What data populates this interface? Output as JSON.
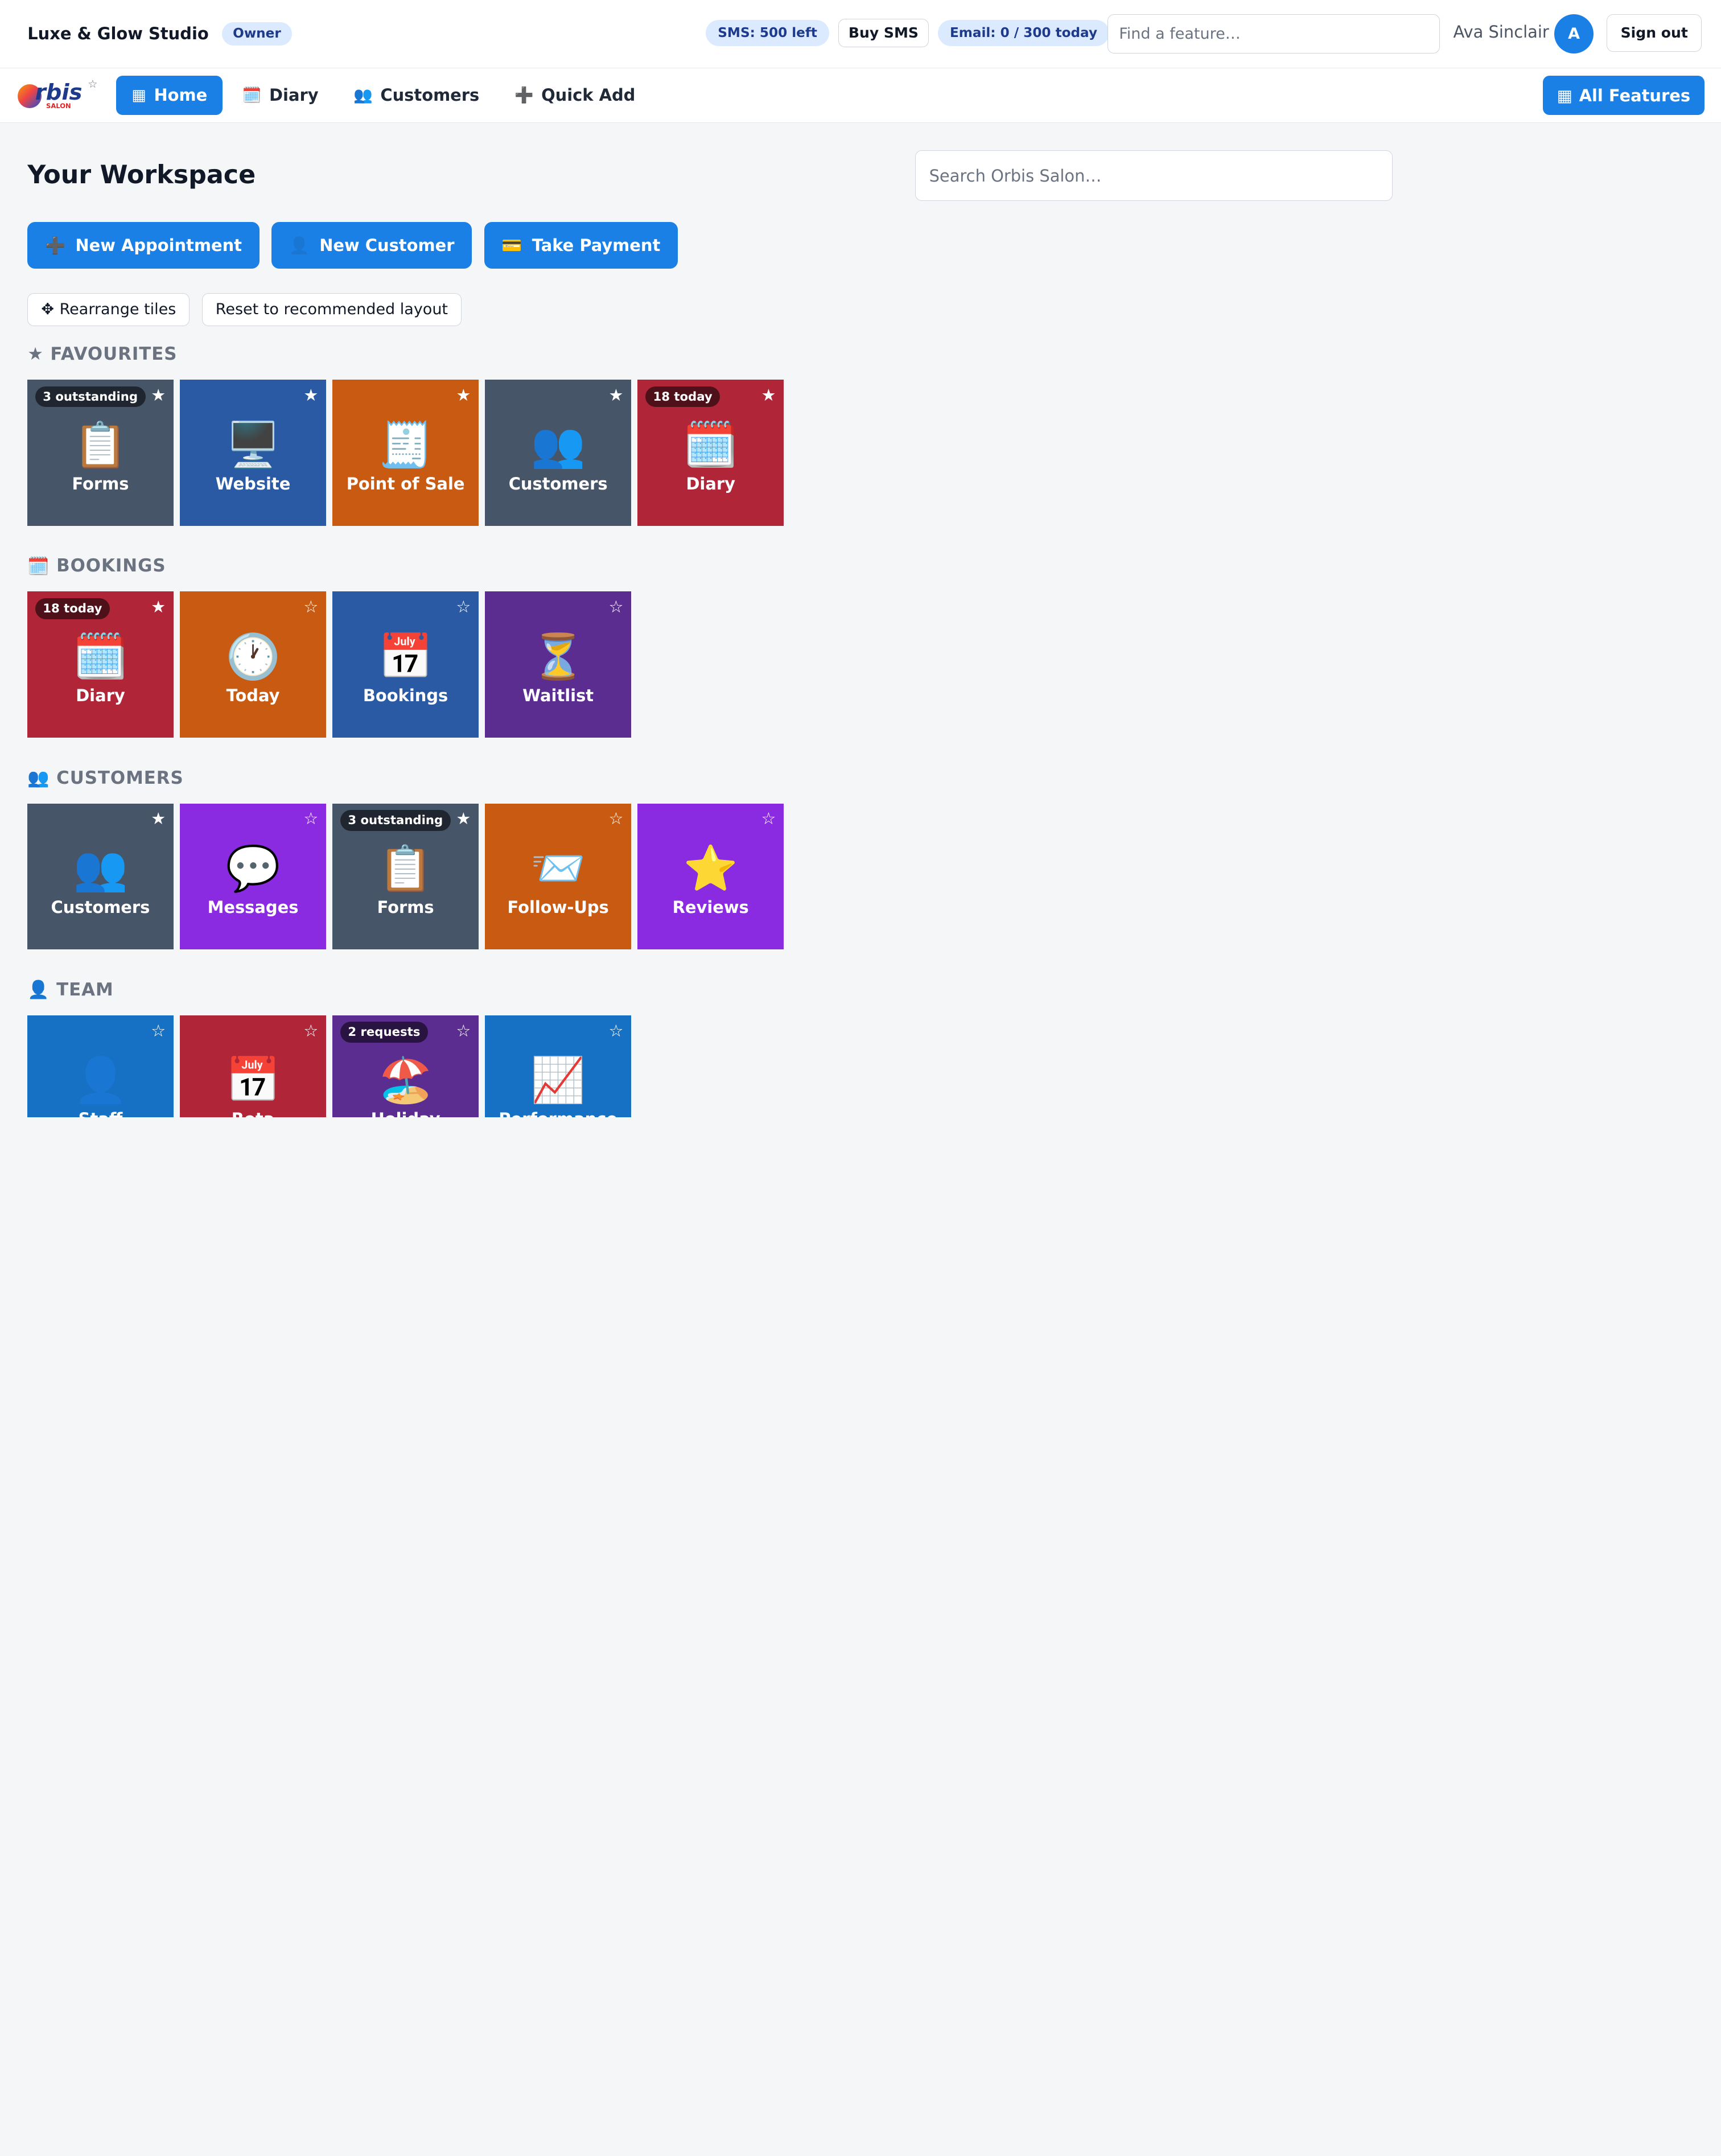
{
  "topbar": {
    "brand": "Luxe & Glow Studio",
    "role": "Owner",
    "sms": "SMS: 500 left",
    "buy_sms": "Buy SMS",
    "email": "Email: 0 / 300 today",
    "find_placeholder": "Find a feature…",
    "user_name": "Ava Sinclair",
    "avatar_initial": "A",
    "sign_out": "Sign out"
  },
  "nav": {
    "logo_text": "rbis",
    "logo_sub": "SALON",
    "items": [
      {
        "label": "Home",
        "icon": "grid-icon",
        "glyph": "▦"
      },
      {
        "label": "Diary",
        "icon": "calendar-icon",
        "glyph": "🗓️"
      },
      {
        "label": "Customers",
        "icon": "people-icon",
        "glyph": "👥"
      },
      {
        "label": "Quick Add",
        "icon": "plus-icon",
        "glyph": "➕"
      }
    ],
    "all_features": "All Features",
    "all_features_glyph": "▦"
  },
  "main": {
    "title": "Your Workspace",
    "search_placeholder": "Search Orbis Salon…",
    "actions": [
      {
        "label": "New Appointment",
        "glyph": "➕"
      },
      {
        "label": "New Customer",
        "glyph": "👤"
      },
      {
        "label": "Take Payment",
        "glyph": "💳"
      }
    ],
    "rearrange": "Rearrange tiles",
    "rearrange_glyph": "✥",
    "reset": "Reset to recommended layout"
  },
  "sections": {
    "favourites": {
      "title": "FAVOURITES",
      "glyph": "★",
      "tiles": [
        {
          "label": "Forms",
          "glyph": "📋",
          "badge": "3 outstanding",
          "star": "★"
        },
        {
          "label": "Website",
          "glyph": "🖥️",
          "badge": "",
          "star": "★"
        },
        {
          "label": "Point of Sale",
          "glyph": "🧾",
          "badge": "",
          "star": "★"
        },
        {
          "label": "Customers",
          "glyph": "👥",
          "badge": "",
          "star": "★"
        },
        {
          "label": "Diary",
          "glyph": "🗓️",
          "badge": "18 today",
          "star": "★"
        }
      ]
    },
    "bookings": {
      "title": "BOOKINGS",
      "glyph": "🗓️",
      "tiles": [
        {
          "label": "Diary",
          "glyph": "🗓️",
          "badge": "18 today",
          "star": "★"
        },
        {
          "label": "Today",
          "glyph": "🕐",
          "badge": "",
          "star": "☆"
        },
        {
          "label": "Bookings",
          "glyph": "📅",
          "badge": "",
          "star": "☆"
        },
        {
          "label": "Waitlist",
          "glyph": "⏳",
          "badge": "",
          "star": "☆"
        }
      ]
    },
    "customers": {
      "title": "CUSTOMERS",
      "glyph": "👥",
      "tiles": [
        {
          "label": "Customers",
          "glyph": "👥",
          "badge": "",
          "star": "★"
        },
        {
          "label": "Messages",
          "glyph": "💬",
          "badge": "",
          "star": "☆"
        },
        {
          "label": "Forms",
          "glyph": "📋",
          "badge": "3 outstanding",
          "star": "★"
        },
        {
          "label": "Follow-Ups",
          "glyph": "📨",
          "badge": "",
          "star": "☆"
        },
        {
          "label": "Reviews",
          "glyph": "⭐",
          "badge": "",
          "star": "☆"
        }
      ]
    },
    "team": {
      "title": "TEAM",
      "glyph": "👤",
      "tiles": [
        {
          "label": "Staff",
          "glyph": "👤",
          "badge": "",
          "star": "☆"
        },
        {
          "label": "Rota",
          "glyph": "📅",
          "badge": "",
          "star": "☆"
        },
        {
          "label": "Holiday",
          "glyph": "🏖️",
          "badge": "2 requests",
          "star": "☆"
        },
        {
          "label": "Performance",
          "glyph": "📈",
          "badge": "",
          "star": "☆"
        }
      ]
    }
  },
  "colors": {
    "accent": "#1a80e5",
    "tile_slate": "#475569",
    "tile_navy": "#2a5aa3",
    "tile_orange": "#c85a12",
    "tile_red": "#b02638",
    "tile_purple": "#5b2d90",
    "tile_violet": "#8a2be2",
    "tile_blue": "#1670c4"
  }
}
